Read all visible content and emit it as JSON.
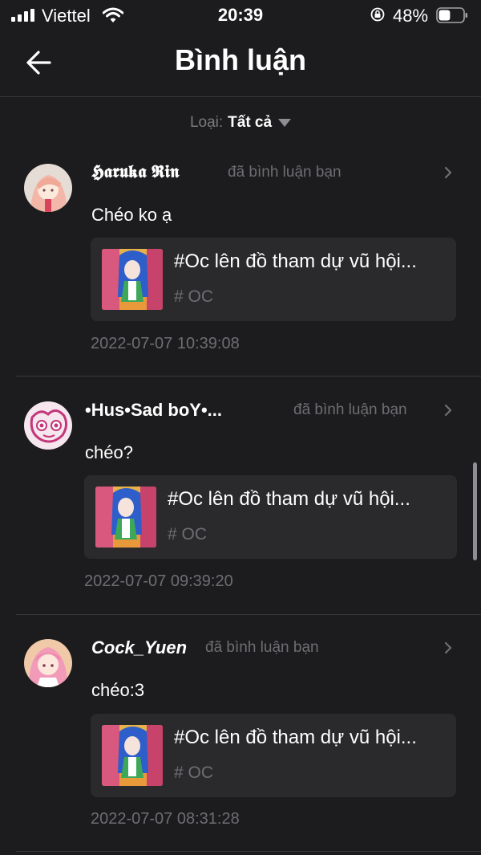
{
  "status_bar": {
    "carrier": "Viettel",
    "time": "20:39",
    "battery_percent": "48%",
    "battery_level": 0.48
  },
  "header": {
    "title": "Bình luận",
    "back_icon": "arrow-left-icon"
  },
  "filter": {
    "label": "Loại:",
    "value": "Tất cả",
    "icon": "caret-down-icon"
  },
  "notifications": [
    {
      "user": "𝕳𝖆𝖗𝖚𝖐𝖆 𝕽𝖎𝖓",
      "action": "đã bình luận bạn",
      "comment": "Chéo ko ạ",
      "post_title": "#Oc lên đồ tham dự vũ hội...",
      "post_tag": "# OC",
      "timestamp": "2022-07-07 10:39:08"
    },
    {
      "user": "•Hus•Sad boY•...",
      "action": "đã bình luận bạn",
      "comment": "chéo?",
      "post_title": "#Oc lên đồ tham dự vũ hội...",
      "post_tag": "# OC",
      "timestamp": "2022-07-07 09:39:20"
    },
    {
      "user": "Cock_Yuen",
      "action": "đã bình luận bạn",
      "comment": "chéo:3",
      "post_title": "#Oc lên đồ tham dự vũ hội...",
      "post_tag": "# OC",
      "timestamp": "2022-07-07 08:31:28"
    }
  ],
  "colors": {
    "background": "#1c1c1e",
    "card": "#2a2a2c",
    "muted_text": "#6e6e72",
    "divider": "#38383a"
  }
}
